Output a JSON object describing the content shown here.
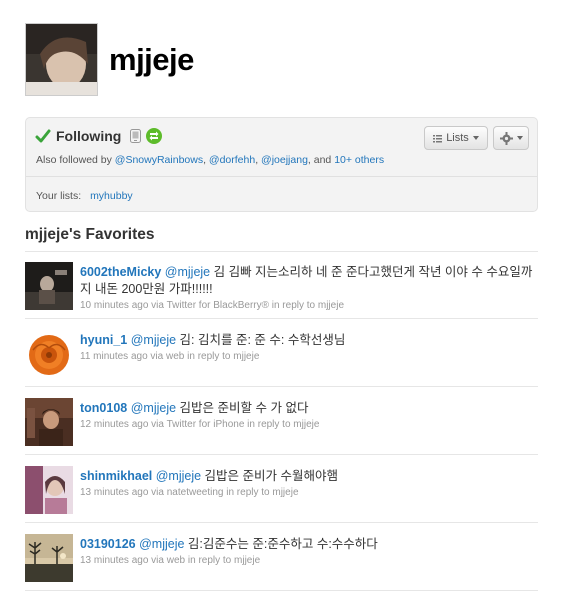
{
  "profile": {
    "screen_name": "mjjeje"
  },
  "follow_box": {
    "status_label": "Following",
    "lists_button_label": "Lists",
    "also_followed_prefix": "Also followed by",
    "also_followed_users": [
      "@SnowyRainbows",
      "@dorfehh",
      "@joejjang"
    ],
    "also_followed_and": ", and",
    "also_followed_more": "10+ others",
    "your_lists_label": "Your lists:",
    "your_lists_item": "myhubby"
  },
  "favorites": {
    "title": "mjjeje's Favorites",
    "tweets": [
      {
        "user": "6002theMicky",
        "mention": "@mjjeje",
        "text": " 김 김빠 지는소리하 네 준 준다고했던게 작년 이야 수 수요일까지 내돈 200만원 가파!!!!!!",
        "time": "10 minutes ago",
        "via": "via",
        "source": "Twitter for BlackBerry®",
        "reply": "in reply to mjjeje"
      },
      {
        "user": "hyuni_1",
        "mention": "@mjjeje",
        "text": " 김: 김치를 준: 준 수: 수학선생님",
        "time": "11 minutes ago",
        "via": "via",
        "source": "web",
        "reply": "in reply to mjjeje"
      },
      {
        "user": "ton0108",
        "mention": "@mjjeje",
        "text": " 김밥은 준비할 수 가 없다",
        "time": "12 minutes ago",
        "via": "via",
        "source": "Twitter for iPhone",
        "reply": "in reply to mjjeje"
      },
      {
        "user": "shinmikhael",
        "mention": "@mjjeje",
        "text": " 김밥은 준비가 수월해야햄",
        "time": "13 minutes ago",
        "via": "via",
        "source": "natetweeting",
        "reply": "in reply to mjjeje"
      },
      {
        "user": "03190126",
        "mention": "@mjjeje",
        "text": " 김:김준수는 준:준수하고 수:수수하다",
        "time": "13 minutes ago",
        "via": "via",
        "source": "web",
        "reply": "in reply to mjjeje"
      }
    ]
  },
  "colors": {
    "link": "#2276bb",
    "check": "#3aa43a",
    "retweet": "#5dbb2a"
  }
}
